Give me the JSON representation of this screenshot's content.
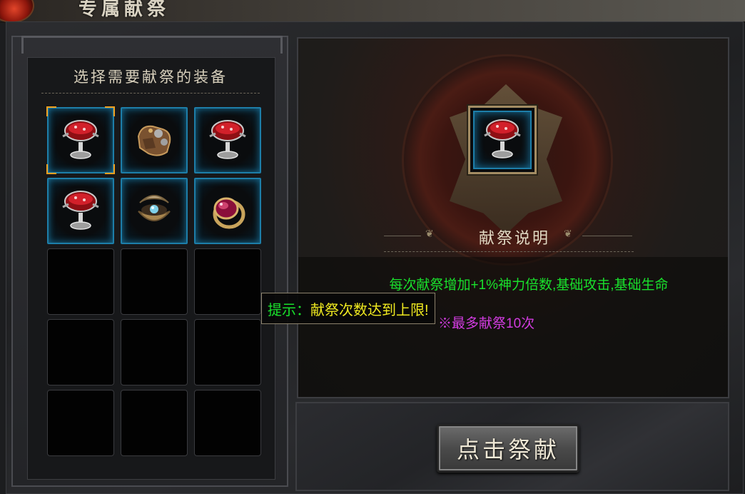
{
  "window": {
    "title": "专属献祭"
  },
  "equipment_panel": {
    "header": "选择需要献祭的装备",
    "slots": [
      {
        "item": "chalice",
        "filled": true,
        "selected": true
      },
      {
        "item": "gauntlet",
        "filled": true,
        "selected": false
      },
      {
        "item": "chalice",
        "filled": true,
        "selected": false
      },
      {
        "item": "chalice",
        "filled": true,
        "selected": false
      },
      {
        "item": "shell",
        "filled": true,
        "selected": false
      },
      {
        "item": "ruby-ring",
        "filled": true,
        "selected": false
      },
      {
        "item": "",
        "filled": false
      },
      {
        "item": "",
        "filled": false
      },
      {
        "item": "",
        "filled": false
      },
      {
        "item": "",
        "filled": false
      },
      {
        "item": "",
        "filled": false
      },
      {
        "item": "",
        "filled": false
      },
      {
        "item": "",
        "filled": false
      },
      {
        "item": "",
        "filled": false
      },
      {
        "item": "",
        "filled": false
      }
    ]
  },
  "sacrifice_panel": {
    "center_item": "chalice",
    "explain_title": "献祭说明",
    "desc_line1": "每次献祭增加+1%神力倍数,基础攻击,基础生命",
    "desc_line2": "※最多献祭10次"
  },
  "tooltip": {
    "label": "提示：",
    "message": "献祭次数达到上限!"
  },
  "action_button": {
    "label": "点击祭献"
  },
  "colors": {
    "slot_border": "#1d7ea9",
    "selected_corner": "#f0a020",
    "desc_green": "#19e02c",
    "desc_purple": "#d23ce0",
    "tooltip_yellow": "#f0ea20"
  }
}
